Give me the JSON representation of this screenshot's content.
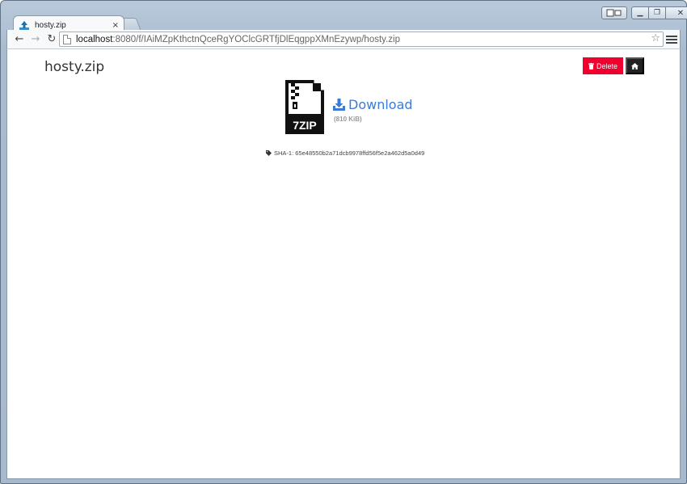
{
  "browser": {
    "tab": {
      "title": "hosty.zip",
      "close_label": "×"
    },
    "url": {
      "host": "localhost",
      "path": ":8080/f/IAiMZpKthctnQceRgYOClcGRTfjDlEqgppXMnEzywp/hosty.zip"
    },
    "caption": {
      "minimize": "▁",
      "restore": "❐",
      "close": "✕"
    },
    "nav": {
      "back": "←",
      "forward": "→",
      "reload": "↻",
      "star": "☆"
    }
  },
  "page": {
    "title": "hosty.zip",
    "delete_label": "Delete",
    "file": {
      "badge": "7ZIP",
      "download_label": "Download",
      "size": "(810 KiB)"
    },
    "hash_label": "SHA-1: 65e48550b2a71dcb9978ffd56f5e2a462d5a0d49"
  },
  "colors": {
    "delete": "#f0002f",
    "home": "#222222",
    "link": "#3a7bd5"
  },
  "icons": [
    "upload-icon",
    "trash-icon",
    "home-icon",
    "file-zip-icon",
    "download-icon",
    "tag-icon",
    "page-icon",
    "star-icon",
    "menu-icon"
  ]
}
